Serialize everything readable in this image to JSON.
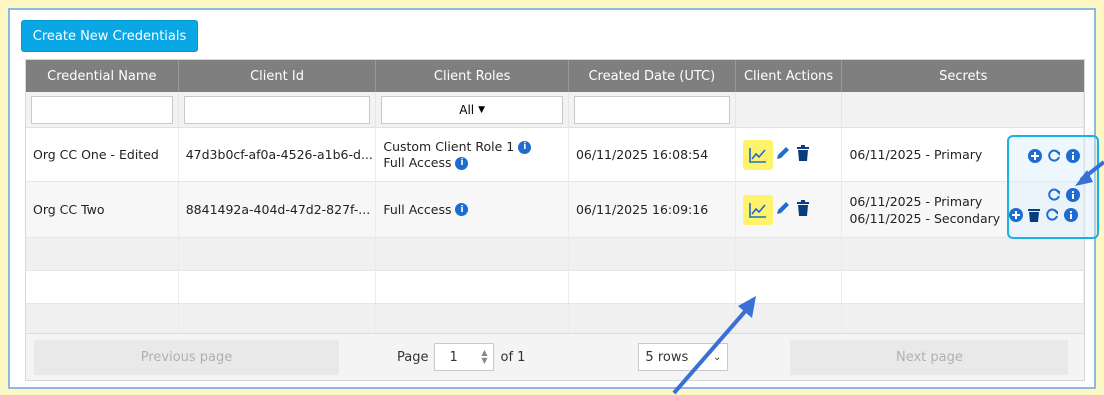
{
  "toolbar": {
    "create_label": "Create New Credentials"
  },
  "columns": [
    "Credential Name",
    "Client Id",
    "Client Roles",
    "Created Date (UTC)",
    "Client Actions",
    "Secrets"
  ],
  "filters": {
    "roles_select": "All"
  },
  "rows": [
    {
      "name": "Org CC One - Edited",
      "client_id": "47d3b0cf-af0a-4526-a1b6-d...",
      "roles": [
        "Custom Client Role 1",
        "Full Access"
      ],
      "created": "06/11/2025 16:08:54",
      "secrets": [
        "06/11/2025 - Primary"
      ]
    },
    {
      "name": "Org CC Two",
      "client_id": "8841492a-404d-47d2-827f-...",
      "roles": [
        "Full Access"
      ],
      "created": "06/11/2025 16:09:16",
      "secrets": [
        "06/11/2025 - Primary",
        "06/11/2025 - Secondary"
      ]
    }
  ],
  "pagination": {
    "prev_label": "Previous page",
    "page_label": "Page",
    "page_value": "1",
    "of_label": "of 1",
    "rows_select": "5 rows",
    "next_label": "Next page"
  },
  "colors": {
    "background": "#fdf7c3",
    "primary_button": "#0aa7e6",
    "header": "#7f7f7f",
    "highlight": "#fff36b",
    "callout": "#19b1e8",
    "arrow": "#3a6fd8",
    "icon": "#1e6ccf"
  },
  "icons": [
    "chart-icon",
    "pencil-icon",
    "trash-icon",
    "plus-circle-icon",
    "refresh-icon",
    "info-icon"
  ]
}
